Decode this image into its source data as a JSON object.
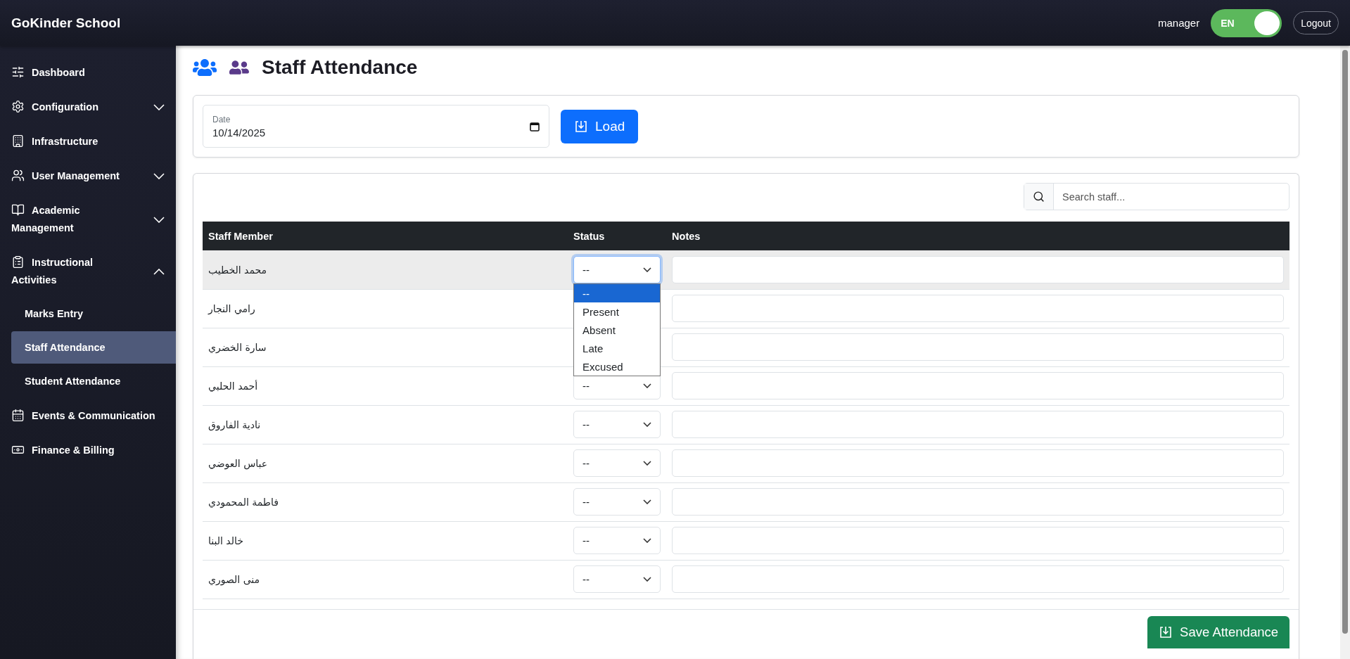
{
  "topbar": {
    "brand": "GoKinder School",
    "user": "manager",
    "language_toggle": {
      "label": "EN",
      "on": true
    },
    "logout": "Logout"
  },
  "sidebar": {
    "items": [
      {
        "label": "Dashboard"
      },
      {
        "label": "Configuration",
        "expanded": false
      },
      {
        "label": "Infrastructure"
      },
      {
        "label": "User Management",
        "expanded": false
      },
      {
        "label": "Academic Management",
        "expanded": false
      },
      {
        "label": "Instructional Activities",
        "expanded": true,
        "children": [
          {
            "label": "Marks Entry",
            "selected": false
          },
          {
            "label": "Staff Attendance",
            "selected": true
          },
          {
            "label": "Student Attendance",
            "selected": false
          }
        ]
      },
      {
        "label": "Events & Communication"
      },
      {
        "label": "Finance & Billing"
      }
    ]
  },
  "page": {
    "title": "Staff Attendance"
  },
  "filter": {
    "date_label": "Date",
    "date_value": "10/14/2025",
    "load_button": "Load"
  },
  "search": {
    "placeholder": "Search staff..."
  },
  "table": {
    "columns": [
      "Staff Member",
      "Status",
      "Notes"
    ],
    "rows": [
      {
        "name": "محمد الخطيب",
        "status": "--",
        "highlighted": true,
        "open": true
      },
      {
        "name": "رامي النجار",
        "highlighted": false
      },
      {
        "name": "سارة الخضري",
        "highlighted": false
      },
      {
        "name": "أحمد الحلبي",
        "status": "--",
        "highlighted": false,
        "open": false
      },
      {
        "name": "نادية الفاروق",
        "status": "--",
        "highlighted": false,
        "open": false
      },
      {
        "name": "عباس العوضي",
        "status": "--",
        "highlighted": false,
        "open": false
      },
      {
        "name": "فاطمة المحمودي",
        "status": "--",
        "highlighted": false,
        "open": false
      },
      {
        "name": "خالد البنا",
        "status": "--",
        "highlighted": false,
        "open": false
      },
      {
        "name": "منى الصوري",
        "status": "--",
        "highlighted": false,
        "open": false
      }
    ]
  },
  "status_options": [
    {
      "label": "--",
      "selected": true
    },
    {
      "label": "Present",
      "selected": false
    },
    {
      "label": "Absent",
      "selected": false
    },
    {
      "label": "Late",
      "selected": false
    },
    {
      "label": "Excused",
      "selected": false
    }
  ],
  "save_button": "Save Attendance"
}
